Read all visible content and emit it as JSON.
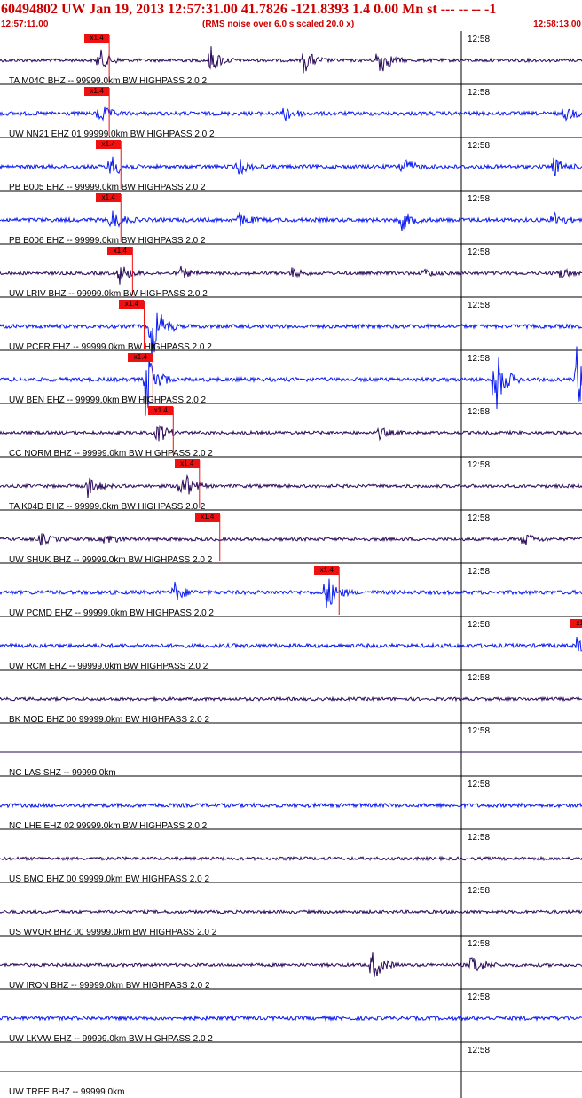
{
  "header": {
    "title": "60494802 UW Jan 19, 2013 12:57:31.00   41.7826 -121.8393  1.4 0.00 Mn st --- -- --   -1",
    "start_time": "12:57:11.00",
    "scale_note": "(RMS noise over 6.0 s scaled 20.0 x)",
    "end_time": "12:58:13.00"
  },
  "minute_mark_label": "12:58",
  "pick_label": "x1.4",
  "colors": {
    "header": "#cc0000",
    "pick": "#ee1111",
    "dark_trace": "#2a0a5a",
    "blue_trace": "#0a1aee"
  },
  "traces": [
    {
      "label": "TA M04C BHZ -- 99999.0km BW  HIGHPASS  2.0  2",
      "color": "dark",
      "pick": 0.145,
      "events": [
        [
          0.17,
          1.0
        ],
        [
          0.36,
          1.3
        ],
        [
          0.52,
          1.2
        ],
        [
          0.65,
          1.5
        ]
      ]
    },
    {
      "label": "UW NN21 EHZ 01 99999.0km BW  HIGHPASS  2.0  2",
      "color": "blue",
      "pick": 0.145,
      "events": [
        [
          0.17,
          0.8
        ],
        [
          0.49,
          0.7
        ],
        [
          0.97,
          0.6
        ]
      ]
    },
    {
      "label": "PB B005 EHZ -- 99999.0km BW  HIGHPASS  2.0  2",
      "color": "blue",
      "pick": 0.165,
      "events": [
        [
          0.19,
          1.0
        ],
        [
          0.41,
          0.6
        ],
        [
          0.69,
          0.9
        ],
        [
          0.95,
          0.8
        ]
      ]
    },
    {
      "label": "PB B006 EHZ -- 99999.0km BW  HIGHPASS  2.0  2",
      "color": "blue",
      "pick": 0.165,
      "events": [
        [
          0.19,
          1.0
        ],
        [
          0.41,
          0.6
        ],
        [
          0.69,
          0.8
        ],
        [
          0.95,
          0.7
        ]
      ]
    },
    {
      "label": "UW LRIV BHZ -- 99999.0km BW  HIGHPASS  2.0  2",
      "color": "dark",
      "pick": 0.185,
      "events": [
        [
          0.205,
          0.9
        ],
        [
          0.31,
          0.5
        ],
        [
          0.5,
          0.4
        ],
        [
          0.73,
          0.3
        ],
        [
          0.96,
          0.5
        ]
      ]
    },
    {
      "label": "UW PCFR EHZ -- 99999.0km BW  HIGHPASS  2.0  2",
      "color": "blue",
      "pick": 0.205,
      "events": [
        [
          0.26,
          3.0
        ]
      ]
    },
    {
      "label": "UW BEN EHZ -- 99999.0km BW  HIGHPASS  2.0  2",
      "color": "blue",
      "pick": 0.22,
      "events": [
        [
          0.25,
          3.0
        ],
        [
          0.85,
          3.0
        ],
        [
          0.99,
          3.0
        ]
      ]
    },
    {
      "label": "CC NORM BHZ -- 99999.0km BW  HIGHPASS  2.0  2",
      "color": "dark",
      "pick": 0.255,
      "events": [
        [
          0.27,
          1.0
        ],
        [
          0.65,
          0.5
        ]
      ]
    },
    {
      "label": "TA K04D BHZ -- 99999.0km BW  HIGHPASS  2.0  2",
      "color": "dark",
      "pick": 0.3,
      "events": [
        [
          0.15,
          1.0
        ],
        [
          0.31,
          1.8
        ]
      ]
    },
    {
      "label": "UW SHUK BHZ -- 99999.0km BW  HIGHPASS  2.0  2",
      "color": "dark",
      "pick": 0.335,
      "events": [
        [
          0.07,
          0.5
        ],
        [
          0.18,
          0.6
        ],
        [
          0.9,
          0.6
        ]
      ]
    },
    {
      "label": "UW PCMD EHZ -- 99999.0km BW  HIGHPASS  2.0  2",
      "color": "blue",
      "pick": 0.54,
      "events": [
        [
          0.3,
          0.8
        ],
        [
          0.56,
          1.6
        ]
      ]
    },
    {
      "label": "UW RCM EHZ -- 99999.0km BW  HIGHPASS  2.0  2",
      "color": "blue",
      "pick": 0.98,
      "events": [
        [
          0.99,
          0.6
        ]
      ]
    },
    {
      "label": "BK MOD BHZ 00 99999.0km BW  HIGHPASS  2.0  2",
      "color": "dark",
      "events": []
    },
    {
      "label": "NC LAS SHZ -- 99999.0km",
      "color": "dark",
      "flat": true,
      "events": []
    },
    {
      "label": "NC LHE EHZ 02 99999.0km BW  HIGHPASS  2.0  2",
      "color": "blue",
      "events": []
    },
    {
      "label": "US BMO BHZ 00 99999.0km BW  HIGHPASS  2.0  2",
      "color": "dark",
      "events": []
    },
    {
      "label": "US WVOR BHZ 00 99999.0km BW  HIGHPASS  2.0  2",
      "color": "dark",
      "events": []
    },
    {
      "label": "UW IRON BHZ -- 99999.0km BW  HIGHPASS  2.0  2",
      "color": "dark",
      "events": [
        [
          0.64,
          1.4
        ],
        [
          0.81,
          1.1
        ]
      ]
    },
    {
      "label": "UW LKVW EHZ -- 99999.0km BW  HIGHPASS  2.0  2",
      "color": "blue",
      "events": []
    },
    {
      "label": "UW TREE BHZ -- 99999.0km",
      "color": "dark",
      "flat": true,
      "events": []
    }
  ]
}
